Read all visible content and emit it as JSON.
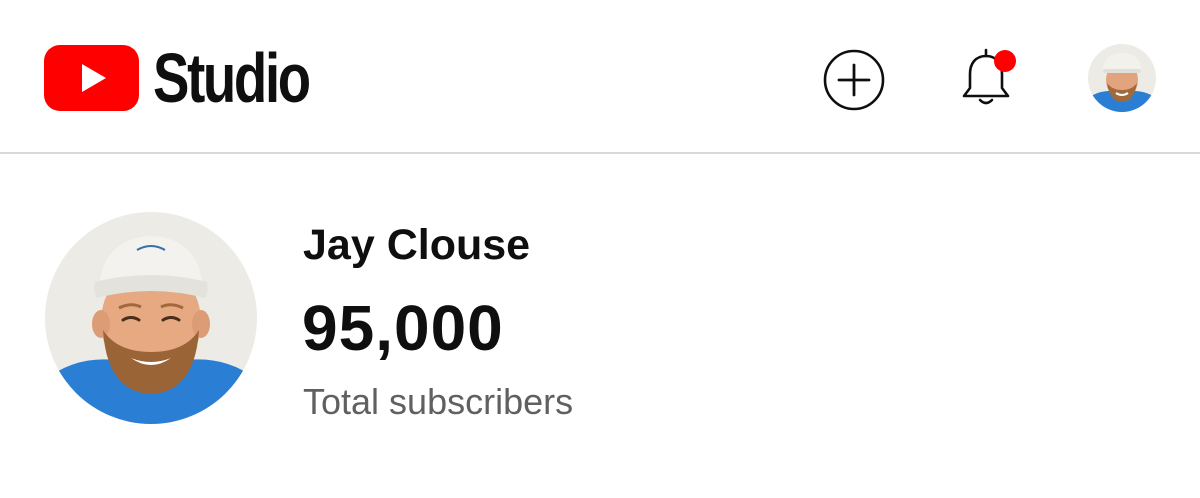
{
  "header": {
    "logo_text": "Studio",
    "logo_icon": "youtube-play-logo",
    "create_icon": "plus-circle-icon",
    "notifications_icon": "bell-icon",
    "notification_dot": true,
    "account_icon": "avatar"
  },
  "channel": {
    "name": "Jay Clouse",
    "subscriber_count": "95,000",
    "subscriber_label": "Total subscribers"
  },
  "colors": {
    "brand_red": "#ff0000",
    "text_primary": "#0f0f0f",
    "text_secondary": "#606060",
    "divider": "#d9d9d9",
    "avatar_shirt": "#2a7fd4"
  }
}
